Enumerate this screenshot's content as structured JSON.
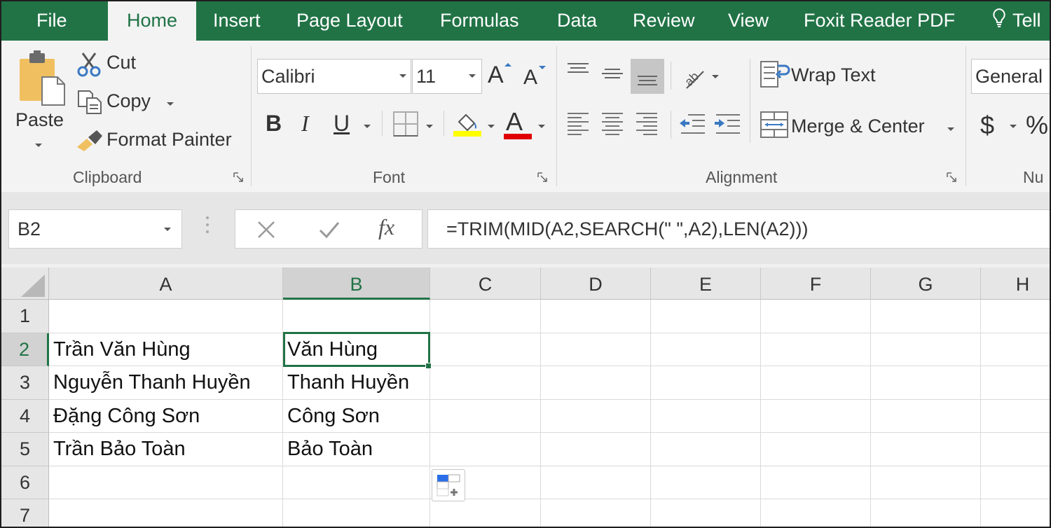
{
  "ribbon_tabs": [
    {
      "label": "File",
      "active": false
    },
    {
      "label": "Home",
      "active": true
    },
    {
      "label": "Insert",
      "active": false
    },
    {
      "label": "Page Layout",
      "active": false
    },
    {
      "label": "Formulas",
      "active": false
    },
    {
      "label": "Data",
      "active": false
    },
    {
      "label": "Review",
      "active": false
    },
    {
      "label": "View",
      "active": false
    },
    {
      "label": "Foxit Reader PDF",
      "active": false
    },
    {
      "label": "Tell",
      "active": false,
      "icon": "lightbulb-icon"
    }
  ],
  "clipboard": {
    "paste_label": "Paste",
    "cut_label": "Cut",
    "copy_label": "Copy",
    "format_painter_label": "Format Painter",
    "group_label": "Clipboard"
  },
  "font": {
    "font_name": "Calibri",
    "font_size": "11",
    "bold_label": "B",
    "italic_label": "I",
    "underline_label": "U",
    "font_color_glyph": "A",
    "grow_glyph": "A",
    "shrink_glyph": "A",
    "highlight_color": "#ffff00",
    "font_color": "#e00000",
    "group_label": "Font"
  },
  "alignment": {
    "wrap_text_label": "Wrap Text",
    "merge_center_label": "Merge & Center",
    "group_label": "Alignment"
  },
  "number": {
    "format_value": "General",
    "currency_glyph": "$",
    "percent_glyph": "%",
    "group_label": "Nu"
  },
  "formula_bar": {
    "name_box": "B2",
    "fx_label": "fx",
    "formula": "=TRIM(MID(A2,SEARCH(\" \",A2),LEN(A2)))"
  },
  "sheet": {
    "columns": [
      "A",
      "B",
      "C",
      "D",
      "E",
      "F",
      "G",
      "H"
    ],
    "selected_column": "B",
    "selected_row": "2",
    "active_cell": "B2",
    "rows": [
      {
        "num": "1",
        "A": "",
        "B": ""
      },
      {
        "num": "2",
        "A": "Trần Văn Hùng",
        "B": "Văn Hùng"
      },
      {
        "num": "3",
        "A": "Nguyễn Thanh Huyền",
        "B": "Thanh Huyền"
      },
      {
        "num": "4",
        "A": "Đặng Công Sơn",
        "B": "Công Sơn"
      },
      {
        "num": "5",
        "A": "Trần Bảo Toàn",
        "B": "Bảo Toàn"
      },
      {
        "num": "6",
        "A": "",
        "B": ""
      },
      {
        "num": "7",
        "A": "",
        "B": ""
      }
    ]
  },
  "colors": {
    "accent": "#217346",
    "ribbon_bg": "#f3f3f3",
    "header_bg": "#e6e6e6"
  }
}
